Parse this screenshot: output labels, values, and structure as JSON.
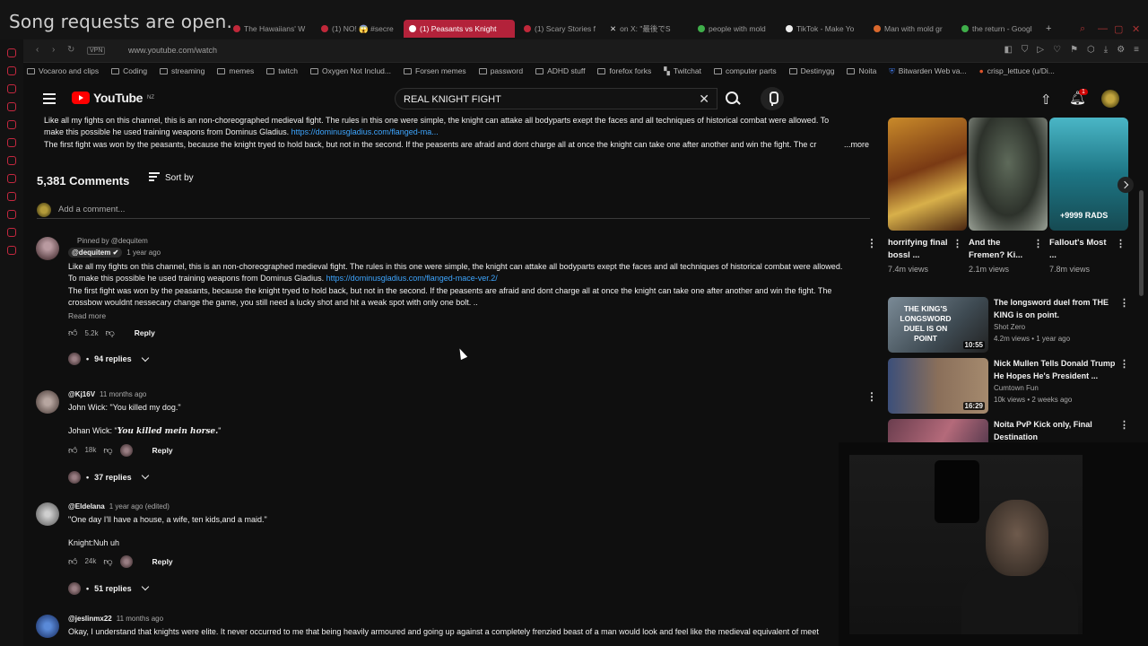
{
  "stream": {
    "title": "Song requests are open."
  },
  "tabs": [
    {
      "label": "The Hawaiians' W"
    },
    {
      "label": "(1) NO! 😱 #secre"
    },
    {
      "label": "(1) Peasants vs Knight",
      "active": true
    },
    {
      "label": "(1) Scary Stories f"
    },
    {
      "label": "on X: \"最後でS"
    },
    {
      "label": "people with mold"
    },
    {
      "label": "TikTok - Make Yo"
    },
    {
      "label": "Man with mold gr"
    },
    {
      "label": "the return - Googl"
    }
  ],
  "address": {
    "vpn": "VPN",
    "url": "www.youtube.com/watch"
  },
  "bookmarks": [
    "Vocaroo and clips",
    "Coding",
    "streaming",
    "memes",
    "twitch",
    "Oxygen Not Includ...",
    "Forsen memes",
    "password",
    "ADHD stuff",
    "forefox forks",
    "Twitchat",
    "computer parts",
    "Destinygg",
    "Noita",
    "Bitwarden Web va...",
    "crisp_lettuce (u/Di..."
  ],
  "header": {
    "logo": "YouTube",
    "region": "NZ",
    "search_value": "REAL KNIGHT FIGHT",
    "notif_count": "1"
  },
  "description": {
    "line1": "Like all my fights on this channel, this is an non-choreographed medieval fight. The rules in this one were simple, the knight can attake all bodyparts exept the faces and all techniques of historical combat were allowed. To",
    "line2_text": "make this possible he used training weapons from Dominus Gladius.",
    "line2_link": "https://dominusgladius.com/flanged-ma...",
    "line3": "The first fight was won by the peasants, because the knight tryed to hold back, but not in the second. If the peasents are afraid and dont charge all at once the knight can take one after another and win the fight. The cr",
    "more": "...more"
  },
  "comments_header": {
    "count": "5,381 Comments",
    "sort": "Sort by"
  },
  "add_comment": {
    "placeholder": "Add a comment..."
  },
  "comments": [
    {
      "pinned": "Pinned by @dequitem",
      "author": "@dequitem",
      "time": "1 year ago",
      "text1": "Like all my fights on this channel, this is an non-choreographed medieval fight. The rules in this one were simple, the knight can attake all bodyparts exept the faces and all techniques of historical combat were allowed.",
      "text2": "To make this possible he used training weapons from Dominus Gladius.",
      "link": "https://dominusgladius.com/flanged-mace-ver.2/",
      "text3": "The first fight was won by the peasants, because the knight tryed to hold back, but not in the second. If the peasents are afraid and dont charge all at once the knight can take one after another and win the fight. The",
      "text4": "crossbow wouldnt nessecary change the game, you still need a lucky shot and hit a weak spot with only one bolt. ..",
      "read_more": "Read more",
      "likes": "5.2k",
      "reply": "Reply",
      "replies": "94 replies"
    },
    {
      "author": "@Kj16V",
      "time": "11 months ago",
      "line1": "John Wick: \"You killed my dog.\"",
      "line2_prefix": "Johan Wick: \"",
      "line2_fancy": "You killed mein horse.",
      "line2_suffix": "\"",
      "likes": "18k",
      "reply": "Reply",
      "replies": "37 replies"
    },
    {
      "author": "@Eldelana",
      "time": "1 year ago (edited)",
      "line1": "\"One day I'll have a house, a wife, ten kids,and a maid.\"",
      "line2": "Knight:Nuh uh",
      "likes": "24k",
      "reply": "Reply",
      "replies": "51 replies"
    },
    {
      "author": "@jeslinmx22",
      "time": "11 months ago",
      "line1": "Okay, I understand that knights were elite. It never occurred to me that being heavily armoured and going up against a completely frenzied beast of a man would look and feel like the medieval equivalent of meet"
    }
  ],
  "shorts": [
    {
      "title": "horrifying final bossl ...",
      "views": "7.4m views"
    },
    {
      "title": "And the Fremen? Ki...",
      "views": "2.1m views"
    },
    {
      "title": "Fallout's Most ...",
      "views": "7.8m views",
      "badge": "+9999 RADS"
    }
  ],
  "videos": [
    {
      "title": "The longsword duel from THE KING is on point.",
      "channel": "Shot Zero",
      "stats": "4.2m views • 1 year ago",
      "duration": "10:55",
      "thumb_text": "THE KING'S LONGSWORD DUEL IS ON POINT"
    },
    {
      "title": "Nick Mullen Tells Donald Trump He Hopes He's President ...",
      "channel": "Cumtown Fun",
      "stats": "10k views • 2 weeks ago",
      "duration": "16:29"
    },
    {
      "title": "Noita PvP Kick only, Final Destination",
      "channel": "",
      "stats": ""
    }
  ]
}
